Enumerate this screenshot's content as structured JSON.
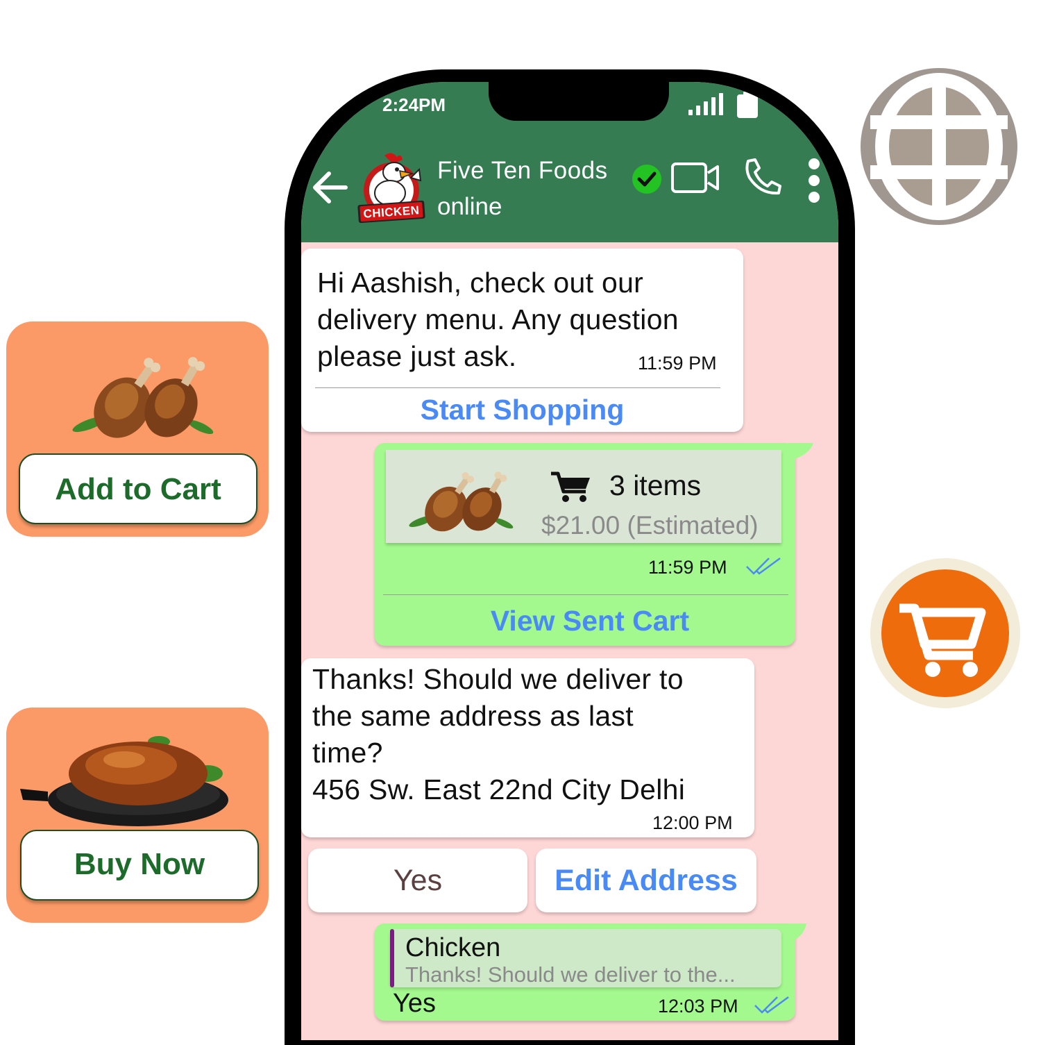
{
  "status_bar": {
    "time": "2:24PM"
  },
  "header": {
    "contact_name": "Five Ten Foods",
    "contact_status": "online",
    "avatar_text": "CHICKEN"
  },
  "messages": {
    "welcome": {
      "lines": [
        "Hi Aashish, check out our",
        "delivery menu. Any question",
        "please just ask."
      ],
      "time": "11:59 PM",
      "action": "Start Shopping"
    },
    "cart": {
      "items": "3 items",
      "price": "$21.00 (Estimated)",
      "time": "11:59 PM",
      "action": "View Sent Cart"
    },
    "address": {
      "lines": [
        "Thanks! Should we deliver to",
        "the same address as last",
        "time?",
        "456 Sw. East 22nd City Delhi"
      ],
      "time": "12:00 PM"
    },
    "quick_replies": {
      "yes": "Yes",
      "edit": "Edit Address"
    },
    "reply": {
      "quoted_author": "Chicken",
      "quoted_text": "Thanks! Should we deliver to the...",
      "text": "Yes",
      "time": "12:03 PM"
    }
  },
  "side_cards": {
    "add_to_cart": "Add to Cart",
    "buy_now": "Buy Now"
  },
  "colors": {
    "header": "#367c52",
    "chat_bg": "#fdd6d6",
    "outgoing": "#a3f98d",
    "link": "#4a8af4",
    "card": "#fc9a67",
    "fab": "#ee6c0b"
  }
}
